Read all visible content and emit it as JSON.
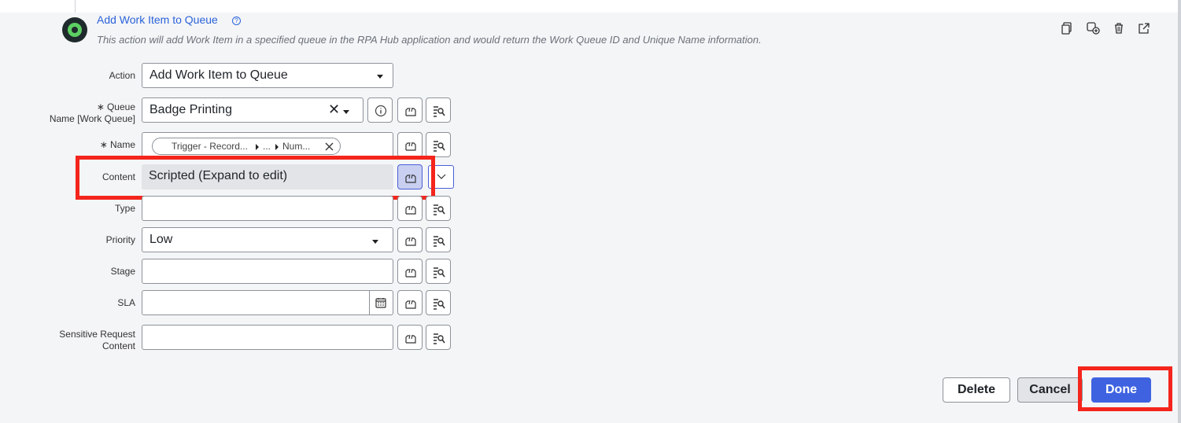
{
  "header": {
    "title": "Add Work Item to Queue",
    "help_glyph": "?",
    "description": "This action will add Work Item in a specified queue in the RPA Hub application and would return the Work Queue ID and Unique Name information.",
    "icons": [
      "copy-icon",
      "duplicate-icon",
      "trash-icon",
      "open-external-icon"
    ]
  },
  "form": {
    "action": {
      "label": "Action",
      "value": "Add Work Item to Queue"
    },
    "queue": {
      "label_line1": "Queue",
      "label_line2": "Name [Work Queue]",
      "required_mark": "∗",
      "value": "Badge Printing",
      "clear_glyph": "✕"
    },
    "name": {
      "label": "Name",
      "required_mark": "∗",
      "pill": {
        "seg1": "Trigger - Record...",
        "seg2": "...",
        "seg3": "Num..."
      }
    },
    "content": {
      "label": "Content",
      "value": "Scripted (Expand to edit)"
    },
    "type": {
      "label": "Type",
      "value": ""
    },
    "priority": {
      "label": "Priority",
      "value": "Low"
    },
    "stage": {
      "label": "Stage",
      "value": ""
    },
    "sla": {
      "label": "SLA",
      "value": ""
    },
    "sensitive": {
      "label_line1": "Sensitive Request",
      "label_line2": "Content",
      "value": ""
    }
  },
  "footer": {
    "delete_label": "Delete",
    "cancel_label": "Cancel",
    "done_label": "Done"
  },
  "colors": {
    "accent": "#3f63e0",
    "link": "#2b63d9",
    "highlight": "#f4251c",
    "logo_green": "#5ccf63"
  }
}
